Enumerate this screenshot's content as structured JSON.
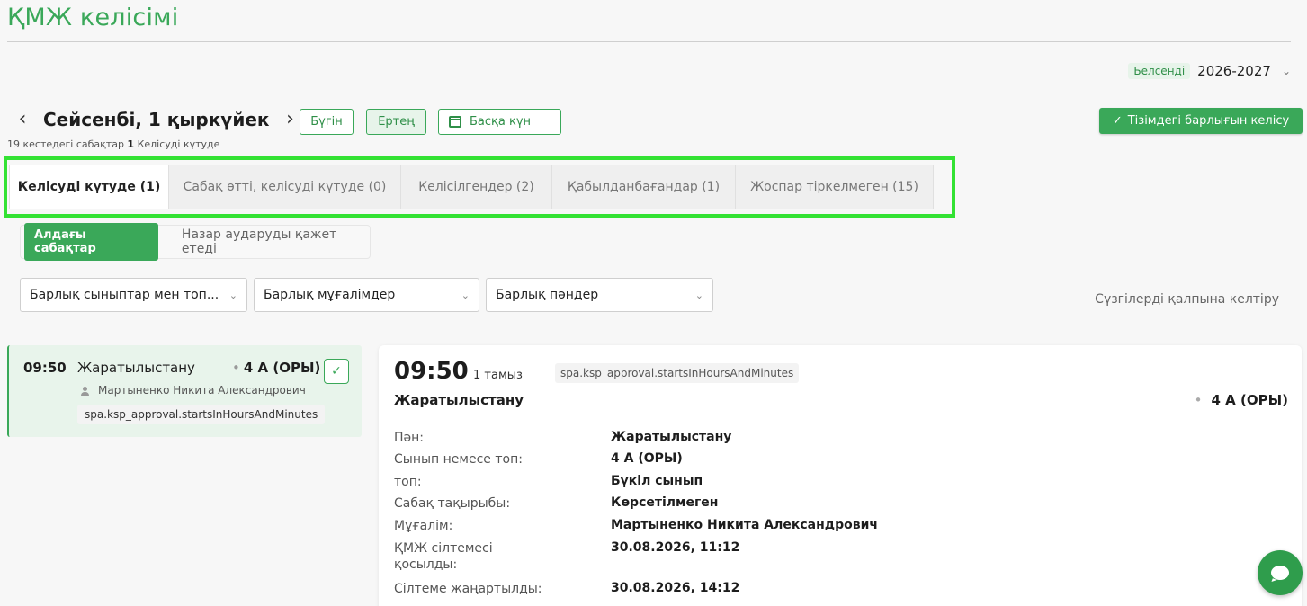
{
  "page": {
    "title": "ҚМЖ келісімі"
  },
  "year_selector": {
    "badge": "Белсенді",
    "value": "2026-2027"
  },
  "date_nav": {
    "title": "Сейсенбі, 1 қыркүйек",
    "today": "Бүгін",
    "tomorrow": "Ертең",
    "other_day": "Басқа күн",
    "summary_prefix": "19 кестедегі сабақтар ",
    "summary_count": "1",
    "summary_suffix": " Келісуді күтуде"
  },
  "approve_all": {
    "label": "Тізімдегі барлығын келісу"
  },
  "tabs": [
    {
      "label": "Келісуді күтуде (1)",
      "active": true
    },
    {
      "label": "Сабақ өтті, келісуді күтуде (0)",
      "active": false
    },
    {
      "label": "Келісілгендер (2)",
      "active": false
    },
    {
      "label": "Қабылданбағандар (1)",
      "active": false
    },
    {
      "label": "Жоспар тіркелмеген (15)",
      "active": false
    }
  ],
  "subtabs": {
    "active": "Алдағы сабақтар",
    "other": "Назар аударуды қажет етеді"
  },
  "filters": {
    "classes": "Барлық сыныптар мен топ...",
    "teachers": "Барлық мұғалімдер",
    "subjects": "Барлық пәндер",
    "reset": "Сүзгілерді қалпына келтіру"
  },
  "lesson": {
    "time": "09:50",
    "subject": "Жаратылыстану",
    "class": "4 А (ОРЫ)",
    "teacher": "Мартыненко Никита Александрович",
    "starts_in": "spa.ksp_approval.startsInHoursAndMinutes"
  },
  "detail": {
    "time": "09:50",
    "date": "1 тамыз",
    "starts_in": "spa.ksp_approval.startsInHoursAndMinutes",
    "subject": "Жаратылыстану",
    "class": "4 А (ОРЫ)",
    "rows": [
      {
        "label": "Пән:",
        "value": "Жаратылыстану"
      },
      {
        "label": "Сынып немесе топ:",
        "value": "4 А (ОРЫ)"
      },
      {
        "label": "топ:",
        "value": "Бүкіл сынып"
      },
      {
        "label": "Сабақ тақырыбы:",
        "value": "Көрсетілмеген"
      },
      {
        "label": "Мұғалім:",
        "value": "Мартыненко Никита Александрович"
      },
      {
        "label": "ҚМЖ сілтемесі қосылды:",
        "value": "30.08.2026, 11:12"
      },
      {
        "label": "Сілтеме жаңартылды:",
        "value": "30.08.2026, 14:12"
      }
    ]
  },
  "icons": {
    "prev": "chevron-left-icon",
    "next": "chevron-right-icon",
    "calendar": "calendar-icon",
    "check": "check-icon",
    "person": "person-icon",
    "chat": "chat-icon"
  },
  "colors": {
    "accent": "#3aa859",
    "highlight_outline": "#33e233"
  }
}
